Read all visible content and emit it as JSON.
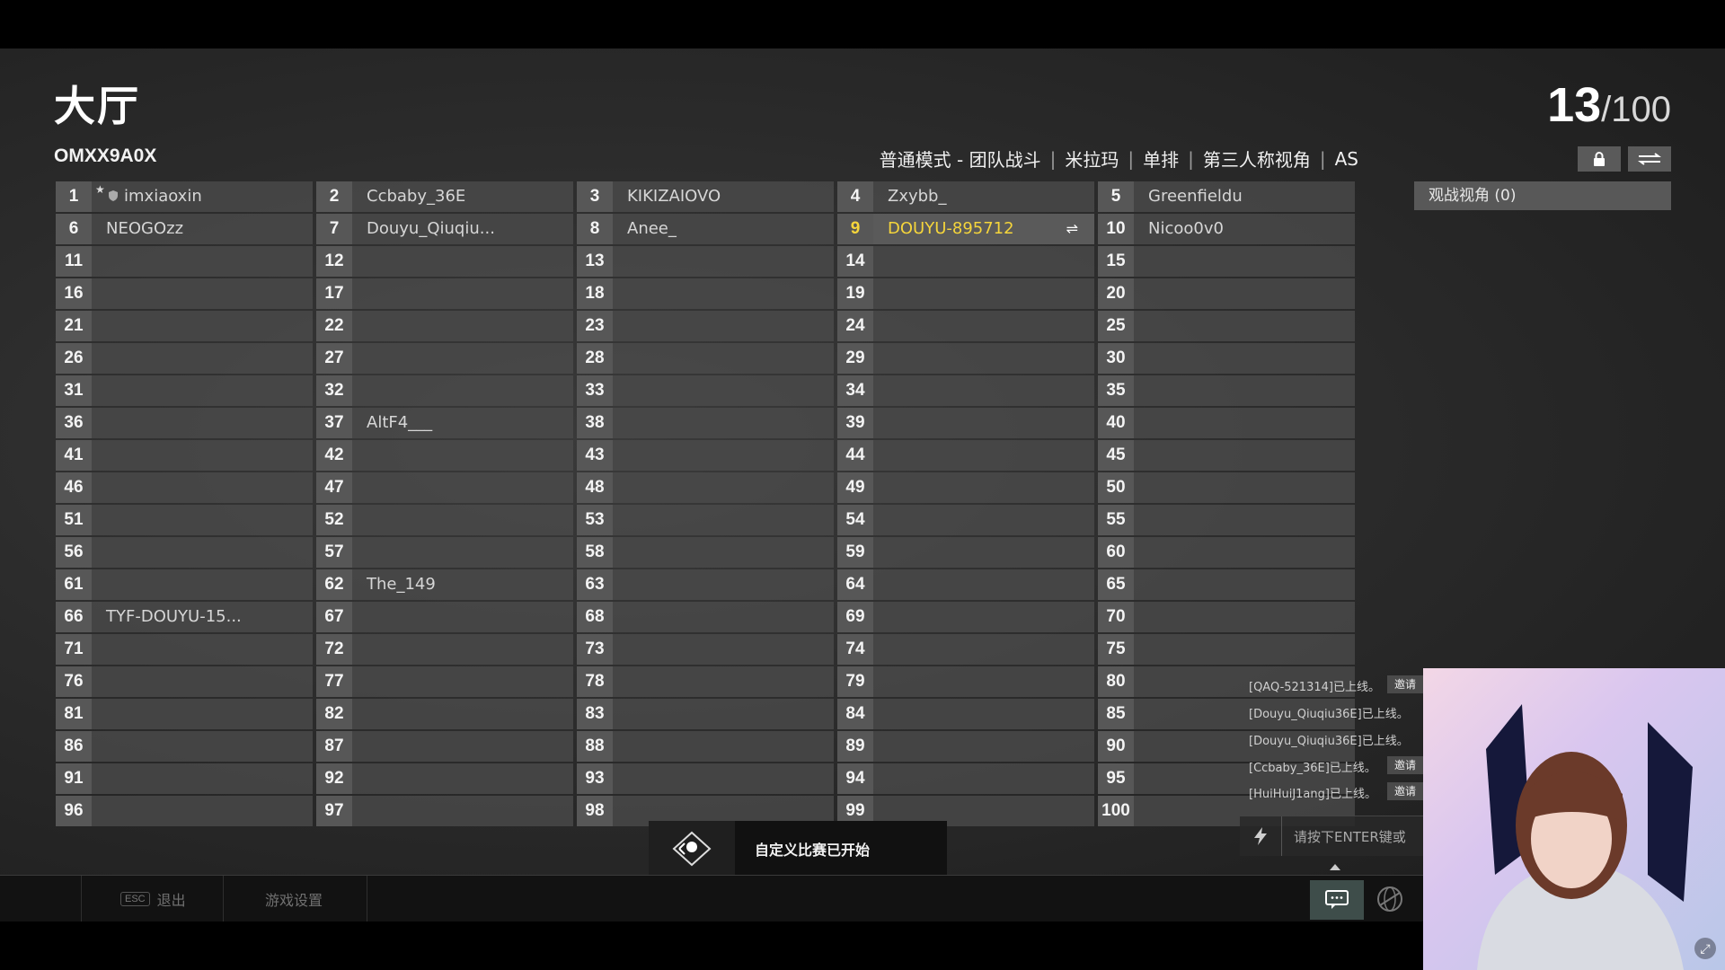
{
  "lobby": {
    "title": "大厅",
    "code": "OMXX9A0X",
    "player_count": "13",
    "capacity": "/100",
    "mode_tags": [
      "普通模式 - 团队战斗",
      "米拉玛",
      "单排",
      "第三人称视角",
      "AS"
    ],
    "lock_icon": "lock-icon",
    "swap_icon": "swap-arrows-icon"
  },
  "slots": [
    {
      "n": "1",
      "name": "imxiaoxin",
      "host": true
    },
    {
      "n": "2",
      "name": "Ccbaby_36E"
    },
    {
      "n": "3",
      "name": "KIKIZAIOVO"
    },
    {
      "n": "4",
      "name": "Zxybb_"
    },
    {
      "n": "5",
      "name": "Greenfieldu"
    },
    {
      "n": "6",
      "name": "NEOGOzz"
    },
    {
      "n": "7",
      "name": "Douyu_Qiuqiu..."
    },
    {
      "n": "8",
      "name": "Anee_"
    },
    {
      "n": "9",
      "name": "DOUYU-895712",
      "self": true
    },
    {
      "n": "10",
      "name": "Nicoo0v0"
    },
    {
      "n": "11",
      "name": ""
    },
    {
      "n": "12",
      "name": ""
    },
    {
      "n": "13",
      "name": ""
    },
    {
      "n": "14",
      "name": ""
    },
    {
      "n": "15",
      "name": ""
    },
    {
      "n": "16",
      "name": ""
    },
    {
      "n": "17",
      "name": ""
    },
    {
      "n": "18",
      "name": ""
    },
    {
      "n": "19",
      "name": ""
    },
    {
      "n": "20",
      "name": ""
    },
    {
      "n": "21",
      "name": ""
    },
    {
      "n": "22",
      "name": ""
    },
    {
      "n": "23",
      "name": ""
    },
    {
      "n": "24",
      "name": ""
    },
    {
      "n": "25",
      "name": ""
    },
    {
      "n": "26",
      "name": ""
    },
    {
      "n": "27",
      "name": ""
    },
    {
      "n": "28",
      "name": ""
    },
    {
      "n": "29",
      "name": ""
    },
    {
      "n": "30",
      "name": ""
    },
    {
      "n": "31",
      "name": ""
    },
    {
      "n": "32",
      "name": ""
    },
    {
      "n": "33",
      "name": ""
    },
    {
      "n": "34",
      "name": ""
    },
    {
      "n": "35",
      "name": ""
    },
    {
      "n": "36",
      "name": ""
    },
    {
      "n": "37",
      "name": "AltF4___"
    },
    {
      "n": "38",
      "name": ""
    },
    {
      "n": "39",
      "name": ""
    },
    {
      "n": "40",
      "name": ""
    },
    {
      "n": "41",
      "name": ""
    },
    {
      "n": "42",
      "name": ""
    },
    {
      "n": "43",
      "name": ""
    },
    {
      "n": "44",
      "name": ""
    },
    {
      "n": "45",
      "name": ""
    },
    {
      "n": "46",
      "name": ""
    },
    {
      "n": "47",
      "name": ""
    },
    {
      "n": "48",
      "name": ""
    },
    {
      "n": "49",
      "name": ""
    },
    {
      "n": "50",
      "name": ""
    },
    {
      "n": "51",
      "name": ""
    },
    {
      "n": "52",
      "name": ""
    },
    {
      "n": "53",
      "name": ""
    },
    {
      "n": "54",
      "name": ""
    },
    {
      "n": "55",
      "name": ""
    },
    {
      "n": "56",
      "name": ""
    },
    {
      "n": "57",
      "name": ""
    },
    {
      "n": "58",
      "name": ""
    },
    {
      "n": "59",
      "name": ""
    },
    {
      "n": "60",
      "name": ""
    },
    {
      "n": "61",
      "name": ""
    },
    {
      "n": "62",
      "name": "The_149"
    },
    {
      "n": "63",
      "name": ""
    },
    {
      "n": "64",
      "name": ""
    },
    {
      "n": "65",
      "name": ""
    },
    {
      "n": "66",
      "name": "TYF-DOUYU-15..."
    },
    {
      "n": "67",
      "name": ""
    },
    {
      "n": "68",
      "name": ""
    },
    {
      "n": "69",
      "name": ""
    },
    {
      "n": "70",
      "name": ""
    },
    {
      "n": "71",
      "name": ""
    },
    {
      "n": "72",
      "name": ""
    },
    {
      "n": "73",
      "name": ""
    },
    {
      "n": "74",
      "name": ""
    },
    {
      "n": "75",
      "name": ""
    },
    {
      "n": "76",
      "name": ""
    },
    {
      "n": "77",
      "name": ""
    },
    {
      "n": "78",
      "name": ""
    },
    {
      "n": "79",
      "name": ""
    },
    {
      "n": "80",
      "name": ""
    },
    {
      "n": "81",
      "name": ""
    },
    {
      "n": "82",
      "name": ""
    },
    {
      "n": "83",
      "name": ""
    },
    {
      "n": "84",
      "name": ""
    },
    {
      "n": "85",
      "name": ""
    },
    {
      "n": "86",
      "name": ""
    },
    {
      "n": "87",
      "name": ""
    },
    {
      "n": "88",
      "name": ""
    },
    {
      "n": "89",
      "name": ""
    },
    {
      "n": "90",
      "name": ""
    },
    {
      "n": "91",
      "name": ""
    },
    {
      "n": "92",
      "name": ""
    },
    {
      "n": "93",
      "name": ""
    },
    {
      "n": "94",
      "name": ""
    },
    {
      "n": "95",
      "name": ""
    },
    {
      "n": "96",
      "name": ""
    },
    {
      "n": "97",
      "name": ""
    },
    {
      "n": "98",
      "name": ""
    },
    {
      "n": "99",
      "name": ""
    },
    {
      "n": "100",
      "name": ""
    }
  ],
  "spectator": {
    "label": "观战视角 (0)"
  },
  "chat": {
    "messages": [
      {
        "text": "[QAQ-521314]已上线。",
        "invite": "邀请"
      },
      {
        "text": "[Douyu_Qiuqiu36E]已上线。",
        "invite": ""
      },
      {
        "text": "[Douyu_Qiuqiu36E]已上线。",
        "invite": ""
      },
      {
        "text": "[Ccbaby_36E]已上线。",
        "invite": "邀请"
      },
      {
        "text": "[HuiHuiJ1ang]已上线。",
        "invite": "邀请"
      }
    ],
    "input_placeholder": "请按下ENTER键或"
  },
  "notice": {
    "text": "自定义比赛已开始"
  },
  "bottom": {
    "esc_key": "ESC",
    "exit_label": "退出",
    "settings_label": "游戏设置"
  },
  "colors": {
    "self_highlight": "#f5d53b",
    "cell_bg": "#4b4b4b",
    "num_bg": "#575757"
  }
}
